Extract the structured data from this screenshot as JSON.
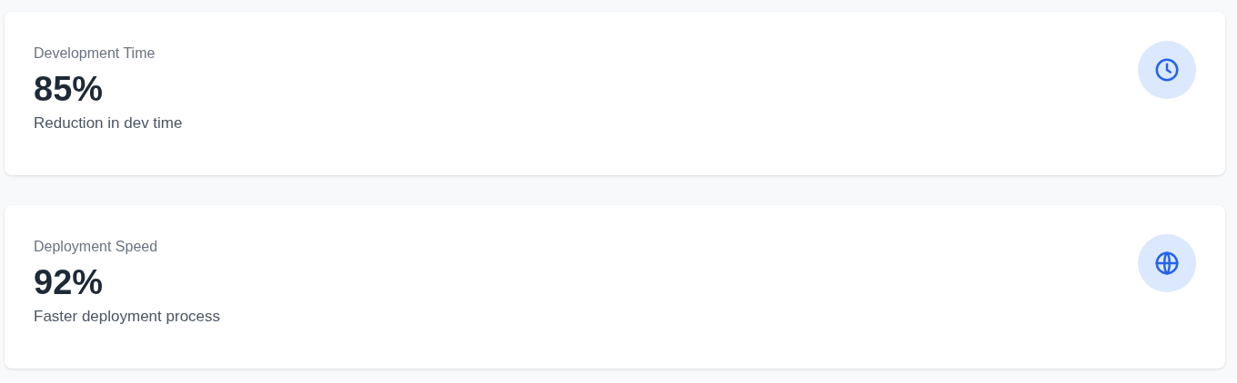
{
  "cards": [
    {
      "label": "Development Time",
      "value": "85%",
      "description": "Reduction in dev time",
      "kind": "clock"
    },
    {
      "label": "Deployment Speed",
      "value": "92%",
      "description": "Faster deployment process",
      "kind": "globe"
    }
  ]
}
